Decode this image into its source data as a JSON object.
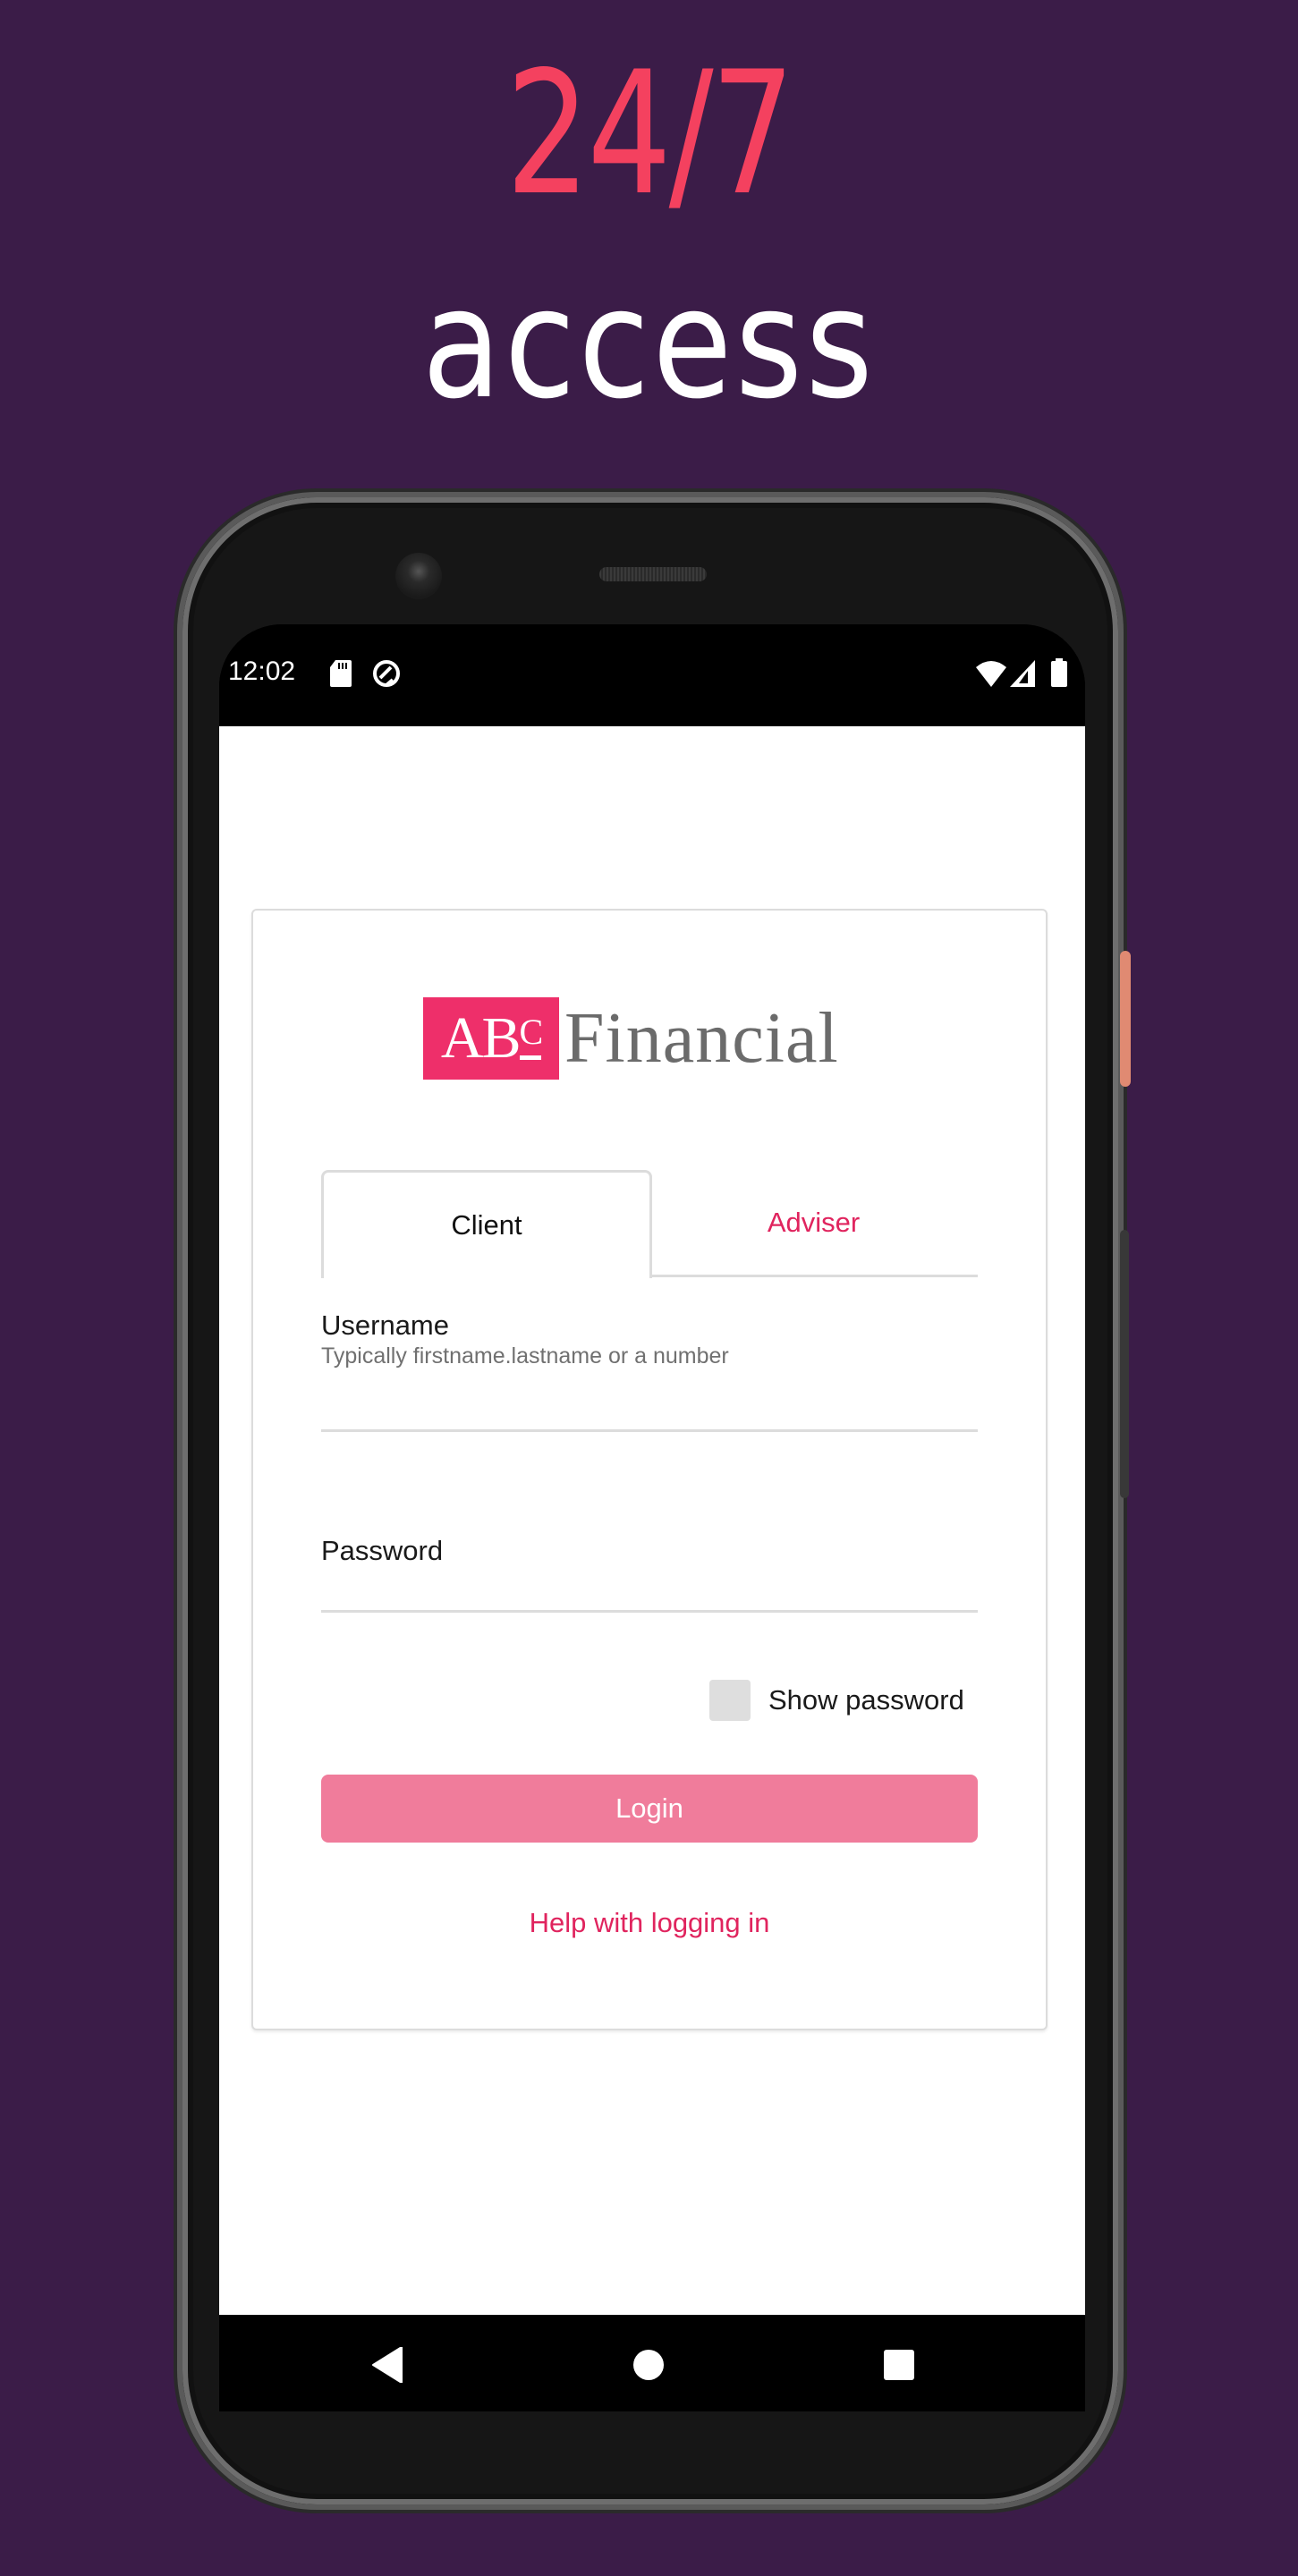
{
  "promo": {
    "headline_accent": "24/7",
    "headline_main": "access",
    "accent_color": "#f4415f",
    "background_color": "#3b1c48"
  },
  "status_bar": {
    "time": "12:02",
    "left_icons": [
      "sd-card-icon",
      "data-saver-icon"
    ],
    "right_icons": [
      "wifi-icon",
      "cell-signal-icon",
      "battery-icon"
    ]
  },
  "app": {
    "logo": {
      "mark_text": "AB",
      "mark_superscript": "C",
      "wordmark": "Financial",
      "brand_color": "#ee2f6a"
    },
    "tabs": [
      {
        "label": "Client",
        "selected": true
      },
      {
        "label": "Adviser",
        "selected": false
      }
    ],
    "username": {
      "label": "Username",
      "hint": "Typically firstname.lastname or a number",
      "value": ""
    },
    "password": {
      "label": "Password",
      "value": ""
    },
    "show_password": {
      "label": "Show password",
      "checked": false
    },
    "login_button": "Login",
    "help_link": "Help with logging in",
    "accent_color": "#e0245e"
  },
  "nav_bar": {
    "buttons": [
      "back-icon",
      "home-icon",
      "recents-icon"
    ]
  }
}
